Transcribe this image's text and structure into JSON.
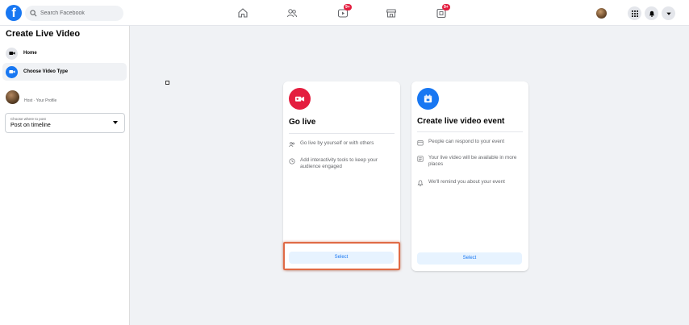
{
  "topbar": {
    "logo_letter": "f",
    "search_placeholder": "Search Facebook",
    "nav": [
      {
        "name": "home",
        "badge": ""
      },
      {
        "name": "friends",
        "badge": ""
      },
      {
        "name": "watch",
        "badge": "9+"
      },
      {
        "name": "marketplace",
        "badge": ""
      },
      {
        "name": "gaming",
        "badge": "9+"
      }
    ]
  },
  "sidebar": {
    "title": "Create Live Video",
    "items": [
      {
        "label": "Home",
        "icon": "video-camera-icon"
      },
      {
        "label": "Choose Video Type",
        "icon": "video-camera-icon"
      }
    ],
    "host_label": "Host · Your Profile",
    "post_select": {
      "label": "Choose where to post",
      "value": "Post on timeline"
    }
  },
  "cards": [
    {
      "title": "Go live",
      "icon_color": "#e41e3f",
      "features": [
        "Go live by yourself or with others",
        "Add interactivity tools to keep your audience engaged"
      ],
      "button": "Select"
    },
    {
      "title": "Create live video event",
      "icon_color": "#1877f2",
      "features": [
        "People can respond to your event",
        "Your live video will be available in more places",
        "We'll remind you about your event"
      ],
      "button": "Select"
    }
  ],
  "colors": {
    "accent": "#1877f2",
    "live_red": "#e41e3f",
    "highlight": "#e06a45"
  }
}
